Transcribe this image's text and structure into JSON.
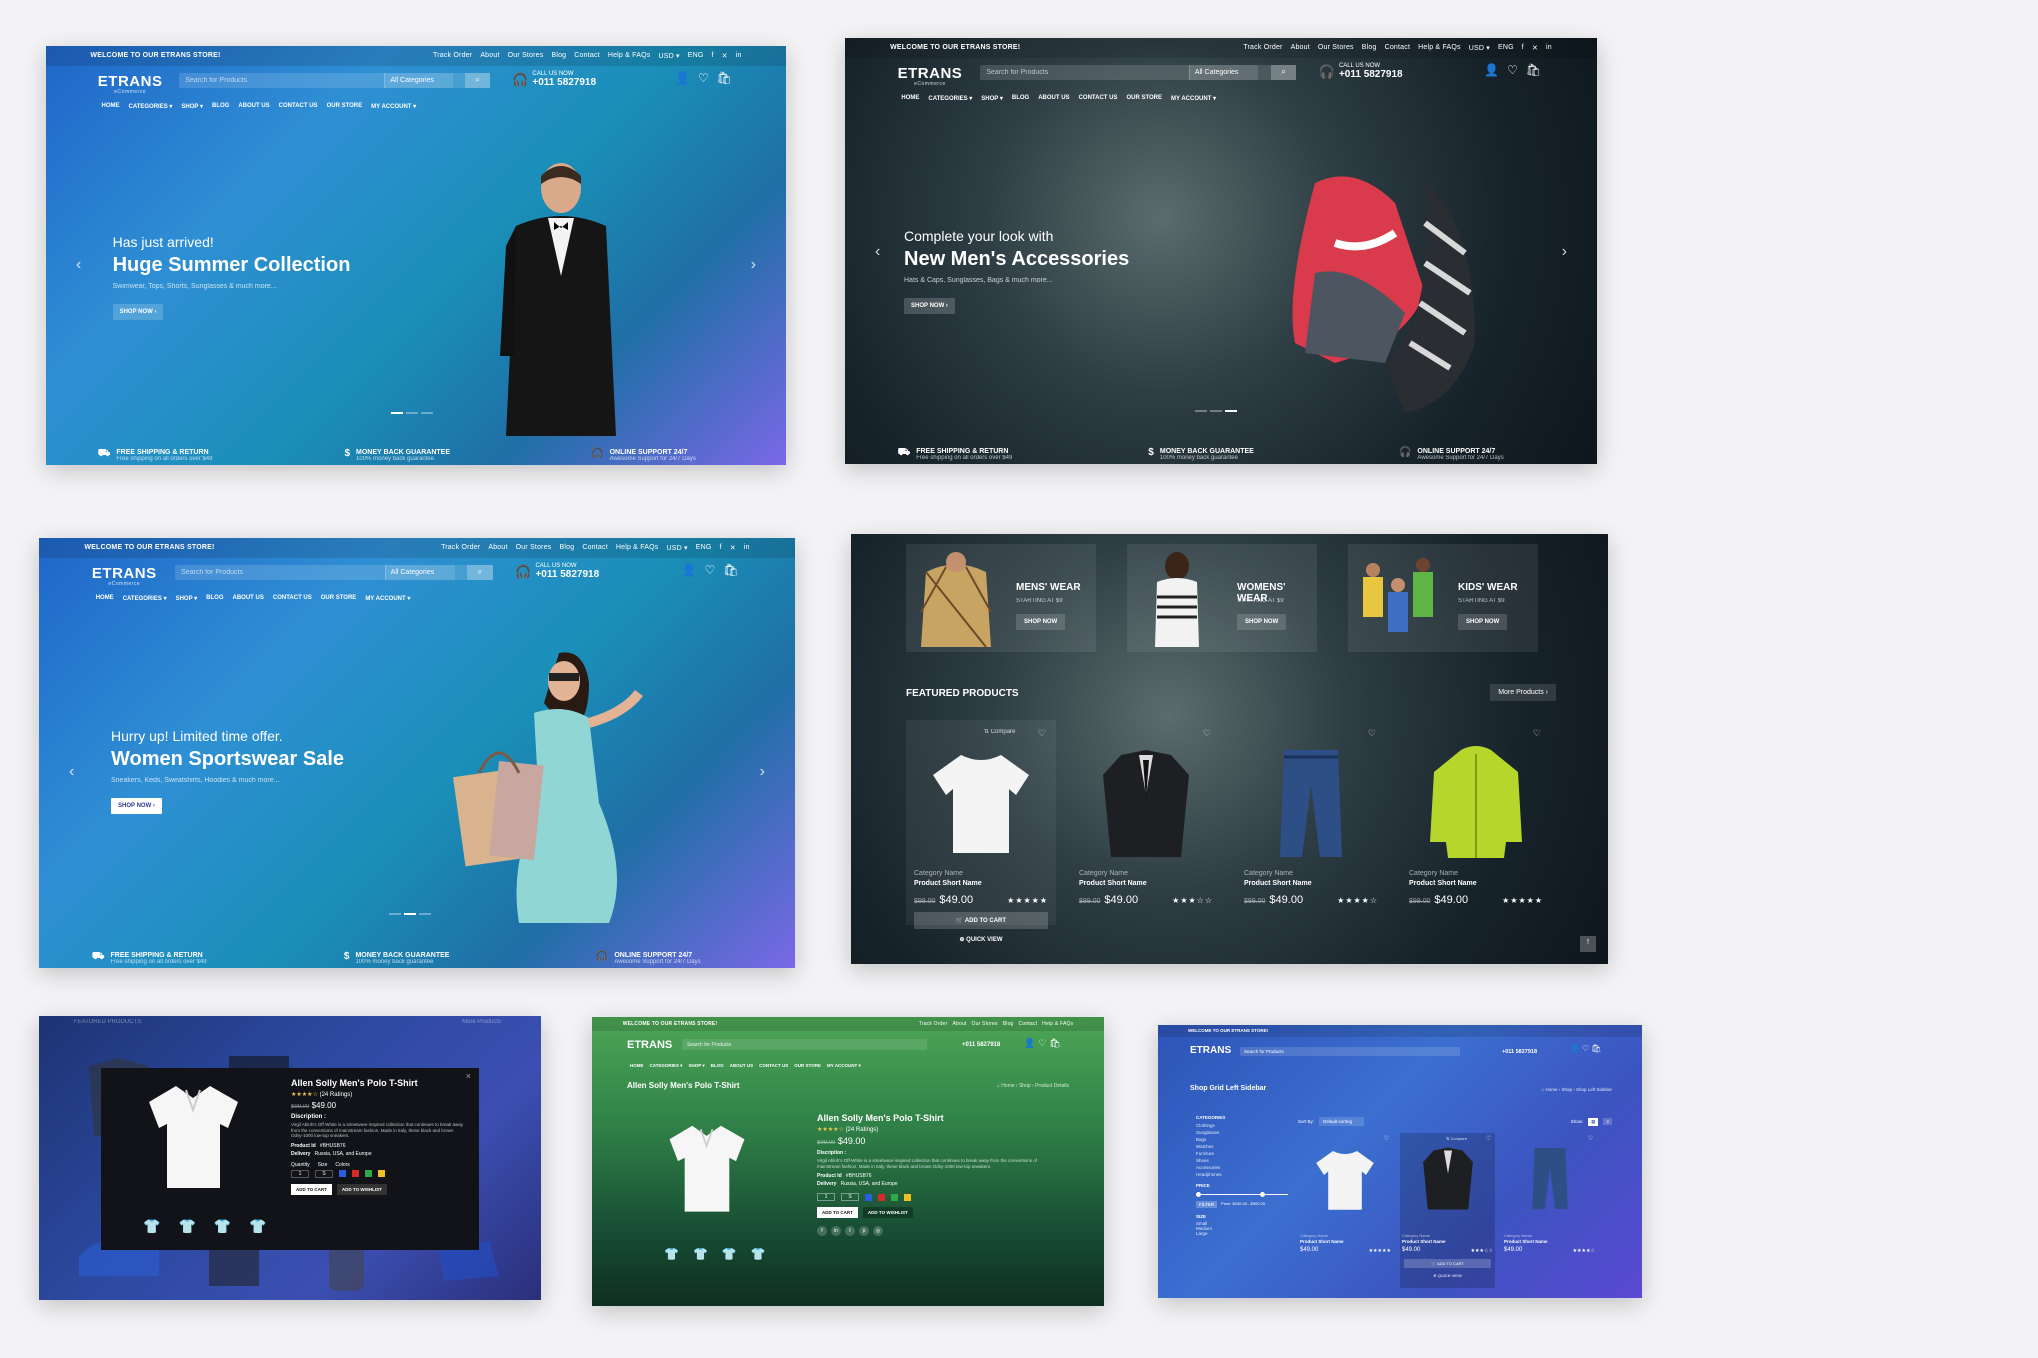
{
  "colors": {
    "accent": "#1f3fa3",
    "star": "#f2c94c",
    "bg": "#f3f3f5"
  },
  "store": {
    "welcome": "WELCOME TO OUR ETRANS STORE!",
    "top_links": [
      "Track Order",
      "About",
      "Our Stores",
      "Blog",
      "Contact",
      "Help & FAQs",
      "USD ▾",
      "ENG",
      "f",
      "✕",
      "in"
    ],
    "logo": "ETRANS",
    "logo_sub": "eCommerce",
    "search_placeholder": "Search for Products",
    "category_select": "All Categories",
    "call_label": "CALL US NOW",
    "call_number": "+011 5827918",
    "nav": [
      "HOME",
      "CATEGORIES ▾",
      "SHOP ▾",
      "BLOG",
      "ABOUT US",
      "CONTACT US",
      "OUR STORE",
      "MY ACCOUNT ▾"
    ],
    "features": [
      {
        "title": "FREE SHIPPING & RETURN",
        "sub": "Free shipping on all orders over $49"
      },
      {
        "title": "MONEY BACK GUARANTEE",
        "sub": "100% money back guarantee"
      },
      {
        "title": "ONLINE SUPPORT 24/7",
        "sub": "Awesome Support for 24/7 Days"
      }
    ]
  },
  "slides": [
    {
      "pre": "Has just arrived!",
      "title": "Huge Summer Collection",
      "sub": "Swimwear, Tops, Shorts, Sunglasses & much more...",
      "btn": "SHOP NOW ›"
    },
    {
      "pre": "Complete your look with",
      "title": "New Men's Accessories",
      "sub": "Hats & Caps, Sunglasses, Bags & much more...",
      "btn": "SHOP NOW ›"
    },
    {
      "pre": "Hurry up! Limited time offer.",
      "title": "Women Sportswear Sale",
      "sub": "Sneakers, Keds, Sweatshirts, Hoodies & much more...",
      "btn": "SHOP NOW ›"
    }
  ],
  "categories": [
    {
      "name": "MENS' WEAR",
      "starting": "STARTING AT $9",
      "btn": "SHOP NOW"
    },
    {
      "name": "WOMENS' WEAR",
      "starting": "STARTING AT $9",
      "btn": "SHOP NOW"
    },
    {
      "name": "KIDS' WEAR",
      "starting": "STARTING AT $9",
      "btn": "SHOP NOW"
    }
  ],
  "featured": {
    "title": "FEATURED PRODUCTS",
    "more": "More Products ›",
    "compare": "⇅ Compare",
    "add_to_cart": "🛒 ADD TO CART",
    "quick_view": "⊕ QUICK VIEW",
    "products": [
      {
        "category": "Category Name",
        "name": "Product Short Name",
        "old": "$99.00",
        "price": "$49.00",
        "stars": "★★★★★",
        "rating": 5
      },
      {
        "category": "Category Name",
        "name": "Product Short Name",
        "old": "$99.00",
        "price": "$49.00",
        "stars": "★★★☆☆",
        "rating": 3
      },
      {
        "category": "Category Name",
        "name": "Product Short Name",
        "old": "$99.00",
        "price": "$49.00",
        "stars": "★★★★☆",
        "rating": 4
      },
      {
        "category": "Category Name",
        "name": "Product Short Name",
        "old": "$99.00",
        "price": "$49.00",
        "stars": "★★★★★",
        "rating": 5
      }
    ]
  },
  "quickview": {
    "title": "Allen Solly Men's Polo T-Shirt",
    "ratings": "(24 Ratings)",
    "old": "$99.00",
    "price": "$49.00",
    "desc_label": "Discription :",
    "desc": "Virgil Abloh's Off-White is a streetwear-inspired collection that continues to break away from the conventions of mainstream fashion. Made in Italy, these black and brown Odsy-1000 low-top sneakers.",
    "product_id_label": "Product Id",
    "product_id": "#BHUSB76",
    "delivery_label": "Delivery",
    "delivery": "Russia, USA, and Europe",
    "qty_label": "Quantity",
    "size_label": "Size",
    "colors_label": "Colors",
    "add_to_cart": "ADD TO CART",
    "wishlist": "ADD TO WISHLIST",
    "featured_bg": "FEATURED PRODUCTS",
    "more_bg": "More Products"
  },
  "detail": {
    "page_title": "Allen Solly Men's Polo T-Shirt",
    "crumb": "⌂ Home  ›  Shop  ›  Product Details"
  },
  "shopgrid": {
    "page_title": "Shop Grid Left Sidebar",
    "crumb": "⌂ Home  ›  Shop  ›  Shop Left Sidebar",
    "categories_label": "CATEGORIES",
    "categories": [
      "Clothings",
      "Sunglasses",
      "Bags",
      "Watches",
      "Furniture",
      "Shoes",
      "Accessories",
      "Headphones"
    ],
    "price_label": "PRICE",
    "filter": "FILTER",
    "price_range": "Price: $200.00 - $900.00",
    "size_label": "SIZE",
    "sizes": [
      "Small",
      "Medium",
      "Large"
    ],
    "sort_label": "Sort By:",
    "sort_value": "Default sorting",
    "show_label": "Show:"
  }
}
